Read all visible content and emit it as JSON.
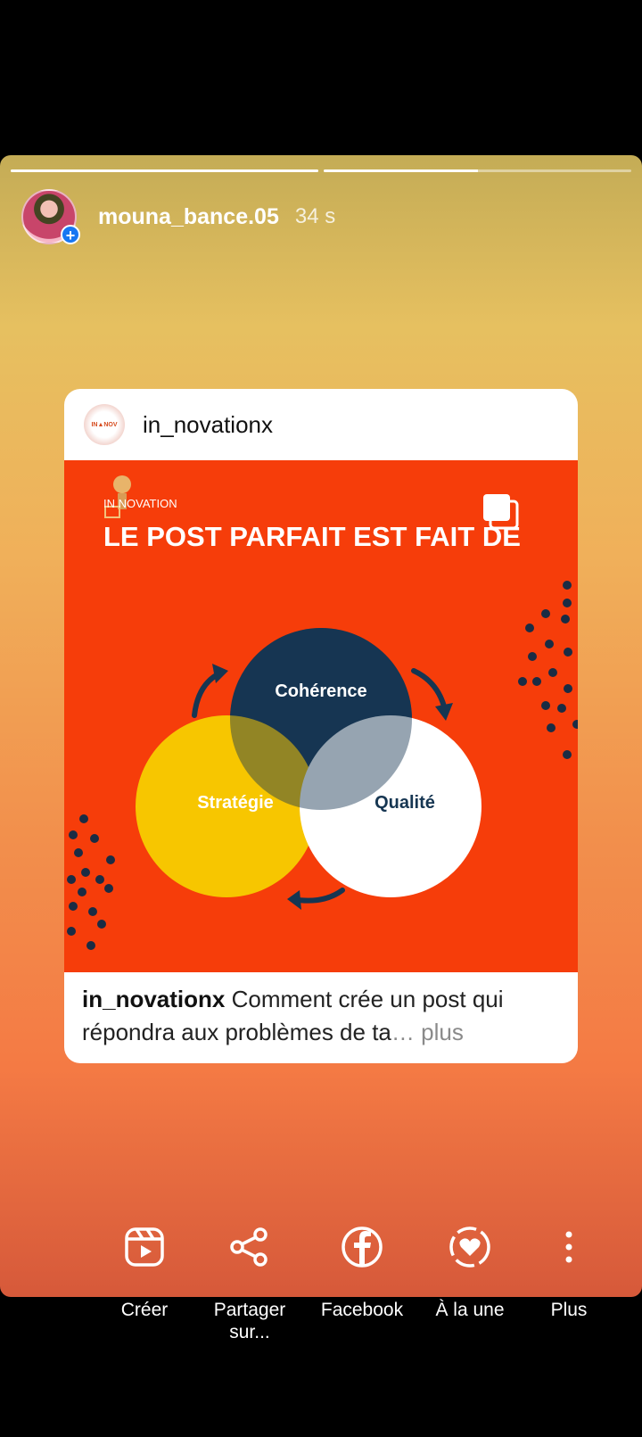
{
  "story": {
    "username": "mouna_bance.05",
    "time": "34 s",
    "progress": [
      1.0,
      0.5
    ]
  },
  "post": {
    "author": "in_novationx",
    "image": {
      "brand": "IN NOVATION",
      "headline": "LE POST PARFAIT EST FAIT DE",
      "circles": [
        "Cohérence",
        "Stratégie",
        "Qualité"
      ]
    },
    "caption_user": "in_novationx",
    "caption_text": " Comment crée un post qui répondra aux problèmes de ta",
    "caption_ellipsis": "… ",
    "caption_more": "plus"
  },
  "actions": [
    {
      "label": "Créer",
      "icon": "reels-icon"
    },
    {
      "label": "Partager sur...",
      "icon": "share-icon"
    },
    {
      "label": "Facebook",
      "icon": "facebook-icon"
    },
    {
      "label": "À la une",
      "icon": "highlight-icon"
    },
    {
      "label": "Plus",
      "icon": "more-vertical-icon"
    }
  ]
}
